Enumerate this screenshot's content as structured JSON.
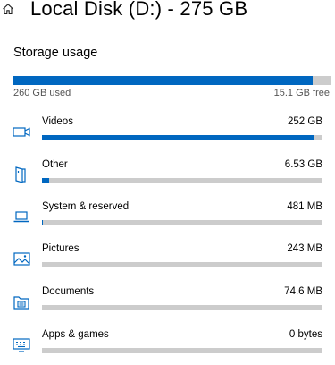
{
  "header": {
    "icon": "home-icon",
    "title": "Local Disk (D:) - 275 GB"
  },
  "storage": {
    "section_title": "Storage usage",
    "used_label": "260 GB used",
    "free_label": "15.1 GB free",
    "used_fraction": 0.945
  },
  "categories": [
    {
      "name": "Videos",
      "size": "252 GB",
      "icon": "video-icon",
      "fraction": 0.97
    },
    {
      "name": "Other",
      "size": "6.53 GB",
      "icon": "book-icon",
      "fraction": 0.025
    },
    {
      "name": "System & reserved",
      "size": "481 MB",
      "icon": "laptop-icon",
      "fraction": 0.003
    },
    {
      "name": "Pictures",
      "size": "243 MB",
      "icon": "picture-icon",
      "fraction": 0.0
    },
    {
      "name": "Documents",
      "size": "74.6 MB",
      "icon": "folder-icon",
      "fraction": 0.0
    },
    {
      "name": "Apps & games",
      "size": "0 bytes",
      "icon": "keyboard-icon",
      "fraction": 0.0
    }
  ],
  "colors": {
    "accent": "#0067c0",
    "track": "#cccccc",
    "icon": "#0067c0"
  }
}
